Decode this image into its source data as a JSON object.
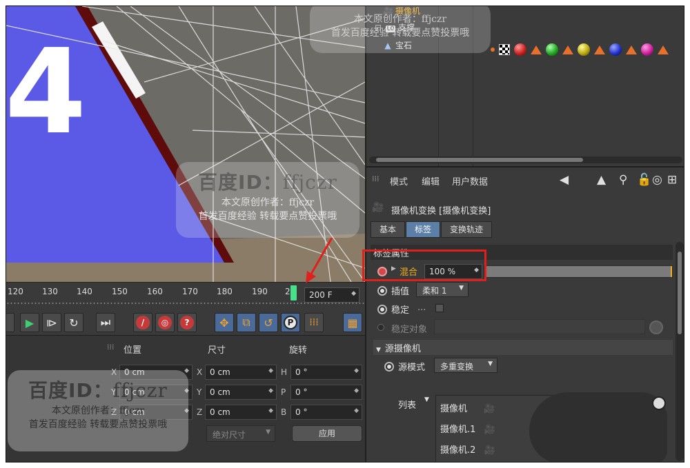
{
  "viewport": {
    "frame_digit": "4"
  },
  "timeline": {
    "ticks": [
      "120",
      "130",
      "140",
      "150",
      "160",
      "170",
      "180",
      "190",
      "2"
    ],
    "end_frame": "200 F"
  },
  "transport": {
    "buttons": [
      "play-forward",
      "next-key",
      "loop",
      "goto-end",
      "record-keyframe",
      "autokey",
      "keyframe-selection",
      "move-key",
      "scale-key",
      "rotate-key",
      "param-key",
      "pla-key",
      "film-strip"
    ]
  },
  "coords": {
    "headers": {
      "position": "位置",
      "size": "尺寸",
      "rotation": "旋转"
    },
    "rows": [
      {
        "axis": "X",
        "pos": "0 cm",
        "size_axis": "X",
        "size": "0 cm",
        "rot_axis": "H",
        "rot": "0 °"
      },
      {
        "axis": "Y",
        "pos": "0 cm",
        "size_axis": "Y",
        "size": "0 cm",
        "rot_axis": "P",
        "rot": "0 °"
      },
      {
        "axis": "Z",
        "pos": "0 cm",
        "size_axis": "Z",
        "size": "0 cm",
        "rot_axis": "B",
        "rot": "0 °"
      }
    ],
    "size_mode": "绝对尺寸",
    "apply_label": "应用"
  },
  "object_manager": {
    "objects": [
      {
        "name": "摄像机",
        "highlight": true
      },
      {
        "name": "支撑"
      },
      {
        "name": "宝石"
      }
    ],
    "tag_colors": [
      "#cc2222",
      "#22aa22",
      "#bbaa11",
      "#2233cc",
      "#cc2299"
    ]
  },
  "attribute_manager": {
    "menu": {
      "mode": "模式",
      "edit": "编辑",
      "user_data": "用户数据"
    },
    "title": "摄像机变换 [摄像机变换]",
    "tabs": [
      {
        "label": "基本",
        "active": false
      },
      {
        "label": "标签",
        "active": true
      },
      {
        "label": "变换轨迹",
        "active": false
      }
    ],
    "section_tag": "标签属性",
    "blend": {
      "label": "混合",
      "value": "100 %",
      "fraction": 1.0
    },
    "interpolation": {
      "label": "插值",
      "value": "柔和 1"
    },
    "stabilize": {
      "label": "稳定",
      "dots": "..."
    },
    "stabilize_target": {
      "label": "稳定对象"
    },
    "section_source": "源摄像机",
    "source_mode": {
      "label": "源模式",
      "value": "多重变换"
    },
    "list": {
      "label": "列表",
      "items": [
        "摄像机",
        "摄像机.1",
        "摄像机.2"
      ]
    }
  },
  "watermarks": {
    "id_text": "百度ID：ffjczr",
    "id_prefix": "百度ID：",
    "id_handle": "ffjczr",
    "author": "本文原创作者：ffjczr",
    "notice": "首发百度经验  转载要点赞投票哦",
    "top_author": "本文原创作者：ffjczr",
    "top_notice": "首发百度经验  转载要点赞投票哦"
  },
  "colors": {
    "accent_blue": "#5b7fa6",
    "highlight_red": "#e0201c",
    "label_orange": "#f0b020",
    "playhead_green": "#49e08b"
  }
}
